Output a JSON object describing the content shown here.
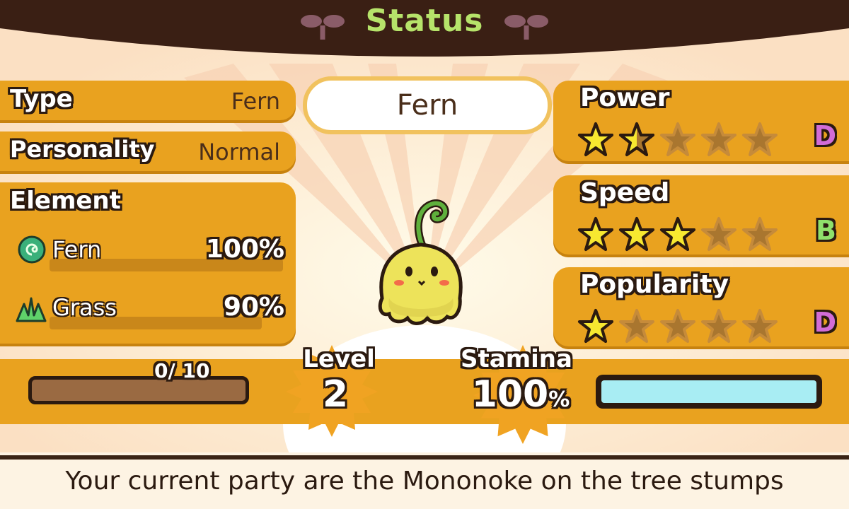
{
  "header": {
    "title": "Status",
    "title_color": "#b6e36a"
  },
  "name": "Fern",
  "info": {
    "type_label": "Type",
    "type_value": "Fern",
    "personality_label": "Personality",
    "personality_value": "Normal",
    "element_label": "Element"
  },
  "elements": [
    {
      "name": "Fern",
      "percent_text": "100%",
      "icon": "fern-swirl-icon"
    },
    {
      "name": "Grass",
      "percent_text": "90%",
      "icon": "grass-icon"
    }
  ],
  "stats": [
    {
      "label": "Power",
      "stars": 1.5,
      "max_stars": 5,
      "grade": "D",
      "grade_color": "#d26cd6"
    },
    {
      "label": "Speed",
      "stars": 3,
      "max_stars": 5,
      "grade": "B",
      "grade_color": "#8fe06b"
    },
    {
      "label": "Popularity",
      "stars": 1,
      "max_stars": 5,
      "grade": "D",
      "grade_color": "#d26cd6"
    }
  ],
  "experience": {
    "text": "0/ 10",
    "fraction": 0
  },
  "level": {
    "label": "Level",
    "value": "2"
  },
  "stamina": {
    "label": "Stamina",
    "value": "100",
    "unit": "%",
    "fraction": 1.0
  },
  "message": "Your current party are the Mononoke on the tree stumps",
  "colors": {
    "panel": "#e9a21f",
    "outline": "#2b1a10",
    "star_filled": "#f7e830",
    "star_empty": "#a9762f"
  }
}
